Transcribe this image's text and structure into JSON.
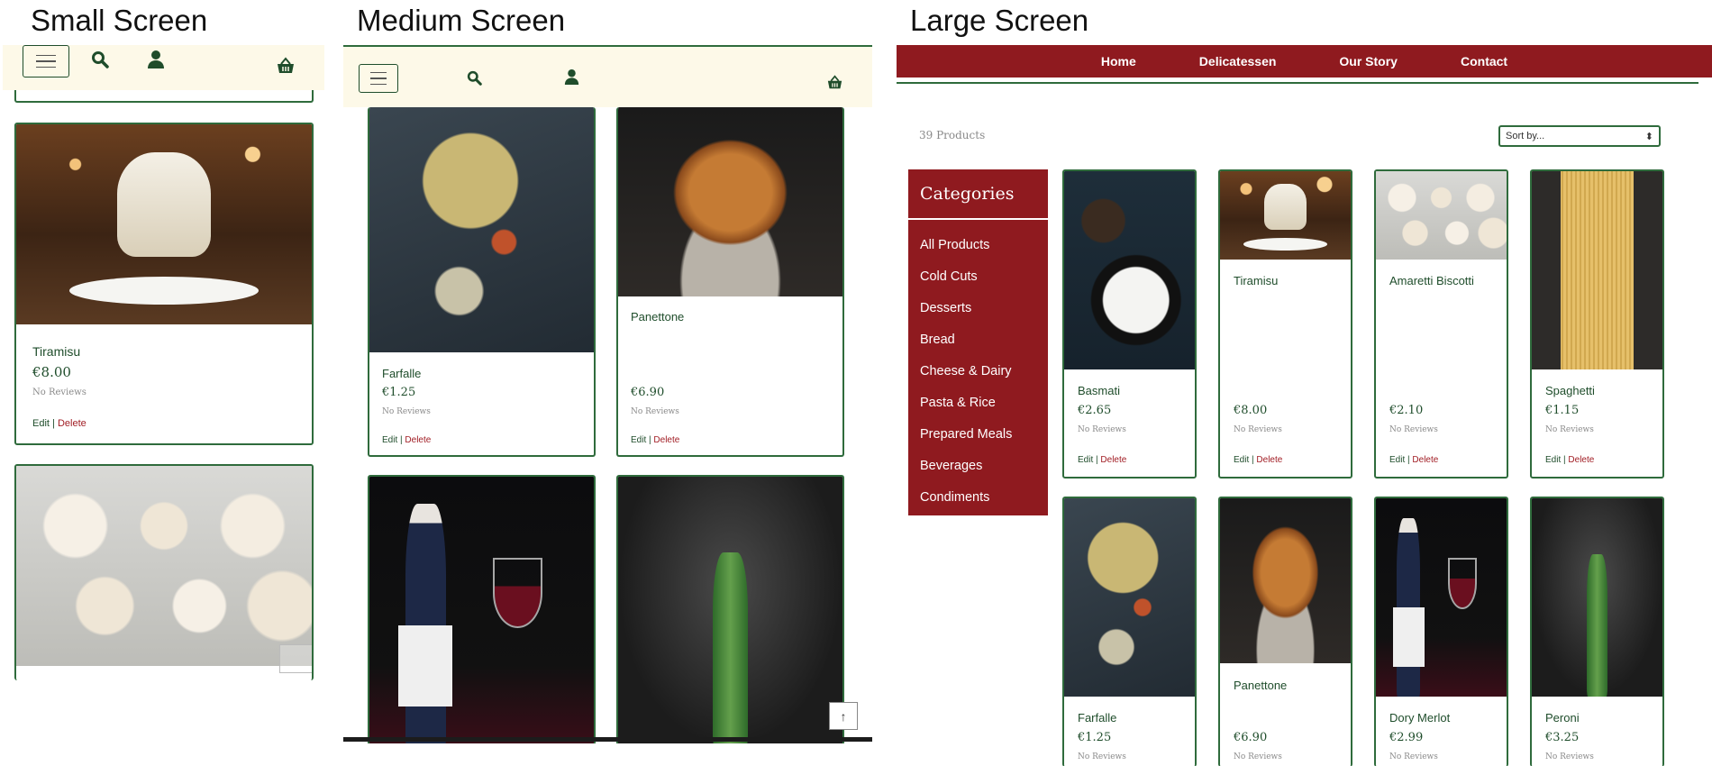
{
  "panels": {
    "small_title": "Small Screen",
    "medium_title": "Medium Screen",
    "large_title": "Large Screen"
  },
  "small": {
    "card": {
      "name": "Tiramisu",
      "price": "€8.00",
      "reviews": "No Reviews",
      "edit": "Edit",
      "sep": "|",
      "delete": "Delete"
    }
  },
  "medium": {
    "cards": [
      {
        "name": "Farfalle",
        "price": "€1.25",
        "reviews": "No Reviews",
        "edit": "Edit",
        "sep": "|",
        "delete": "Delete"
      },
      {
        "name": "Panettone",
        "price": "€6.90",
        "reviews": "No Reviews",
        "edit": "Edit",
        "sep": "|",
        "delete": "Delete"
      }
    ],
    "scroll_top": "↑"
  },
  "large": {
    "nav": [
      "Home",
      "Delicatessen",
      "Our Story",
      "Contact"
    ],
    "product_count": "39 Products",
    "sort_placeholder": "Sort by...",
    "sort_arrow": "⬍",
    "categories_title": "Categories",
    "categories": [
      "All Products",
      "Cold Cuts",
      "Desserts",
      "Bread",
      "Cheese & Dairy",
      "Pasta & Rice",
      "Prepared Meals",
      "Beverages",
      "Condiments"
    ],
    "products": [
      {
        "name": "Basmati",
        "price": "€2.65",
        "reviews": "No Reviews",
        "edit": "Edit",
        "sep": "|",
        "delete": "Delete"
      },
      {
        "name": "Tiramisu",
        "price": "€8.00",
        "reviews": "No Reviews",
        "edit": "Edit",
        "sep": "|",
        "delete": "Delete"
      },
      {
        "name": "Amaretti Biscotti",
        "price": "€2.10",
        "reviews": "No Reviews",
        "edit": "Edit",
        "sep": "|",
        "delete": "Delete"
      },
      {
        "name": "Spaghetti",
        "price": "€1.15",
        "reviews": "No Reviews",
        "edit": "Edit",
        "sep": "|",
        "delete": "Delete"
      },
      {
        "name": "Farfalle",
        "price": "€1.25",
        "reviews": "No Reviews"
      },
      {
        "name": "Panettone",
        "price": "€6.90",
        "reviews": "No Reviews"
      },
      {
        "name": "Dory Merlot",
        "price": "€2.99",
        "reviews": "No Reviews"
      },
      {
        "name": "Peroni",
        "price": "€3.25",
        "reviews": "No Reviews"
      }
    ]
  },
  "colors": {
    "brand_red": "#8f1a1f",
    "brand_green": "#2f6b3c",
    "header_cream": "#fdf9e8",
    "delete_red": "#a11d24"
  },
  "icons": [
    "hamburger-icon",
    "search-icon",
    "user-icon",
    "basket-icon",
    "sort-arrow-icon",
    "arrow-up-icon"
  ]
}
